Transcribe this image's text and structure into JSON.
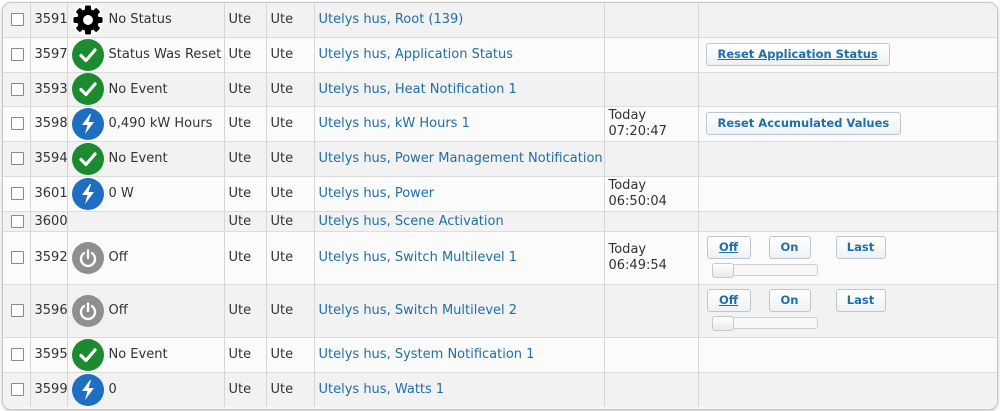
{
  "rows": [
    {
      "id": "3591",
      "icon": "gear-icon",
      "status": "No Status",
      "loc1": "Ute",
      "loc2": "Ute",
      "name": "Utelys hus, Root (139)",
      "time_day": "",
      "time_clock": ""
    },
    {
      "id": "3597",
      "icon": "checkmark-icon",
      "status": "Status Was Reset",
      "loc1": "Ute",
      "loc2": "Ute",
      "name": "Utelys hus, Application Status",
      "time_day": "",
      "time_clock": "",
      "action": "Reset Application Status"
    },
    {
      "id": "3593",
      "icon": "checkmark-icon",
      "status": "No Event",
      "loc1": "Ute",
      "loc2": "Ute",
      "name": "Utelys hus, Heat Notification 1",
      "time_day": "",
      "time_clock": ""
    },
    {
      "id": "3598",
      "icon": "lightning-icon",
      "status": "0,490 kW Hours",
      "loc1": "Ute",
      "loc2": "Ute",
      "name": "Utelys hus, kW Hours 1",
      "time_day": "Today",
      "time_clock": "07:20:47",
      "action": "Reset Accumulated Values"
    },
    {
      "id": "3594",
      "icon": "checkmark-icon",
      "status": "No Event",
      "loc1": "Ute",
      "loc2": "Ute",
      "name": "Utelys hus, Power Management Notification 1",
      "time_day": "",
      "time_clock": ""
    },
    {
      "id": "3601",
      "icon": "lightning-icon",
      "status": "0 W",
      "loc1": "Ute",
      "loc2": "Ute",
      "name": "Utelys hus, Power",
      "time_day": "Today",
      "time_clock": "06:50:04"
    },
    {
      "id": "3600",
      "icon": "",
      "status": "",
      "loc1": "Ute",
      "loc2": "Ute",
      "name": "Utelys hus, Scene Activation",
      "time_day": "",
      "time_clock": ""
    },
    {
      "id": "3592",
      "icon": "power-icon",
      "status": "Off",
      "loc1": "Ute",
      "loc2": "Ute",
      "name": "Utelys hus, Switch Multilevel 1",
      "time_day": "Today",
      "time_clock": "06:49:54",
      "controls": {
        "off": "Off",
        "on": "On",
        "last": "Last",
        "level": 0
      }
    },
    {
      "id": "3596",
      "icon": "power-icon",
      "status": "Off",
      "loc1": "Ute",
      "loc2": "Ute",
      "name": "Utelys hus, Switch Multilevel 2",
      "time_day": "",
      "time_clock": "",
      "controls": {
        "off": "Off",
        "on": "On",
        "last": "Last",
        "level": 0
      }
    },
    {
      "id": "3595",
      "icon": "checkmark-icon",
      "status": "No Event",
      "loc1": "Ute",
      "loc2": "Ute",
      "name": "Utelys hus, System Notification 1",
      "time_day": "",
      "time_clock": ""
    },
    {
      "id": "3599",
      "icon": "lightning-icon",
      "status": "0",
      "loc1": "Ute",
      "loc2": "Ute",
      "name": "Utelys hus, Watts 1",
      "time_day": "",
      "time_clock": ""
    }
  ],
  "colors": {
    "link": "#1f6fa8",
    "ok_icon": "#1c8a2e",
    "energy_icon": "#1e6fc2",
    "power_icon": "#8f8f8f",
    "gear_icon": "#000000"
  }
}
